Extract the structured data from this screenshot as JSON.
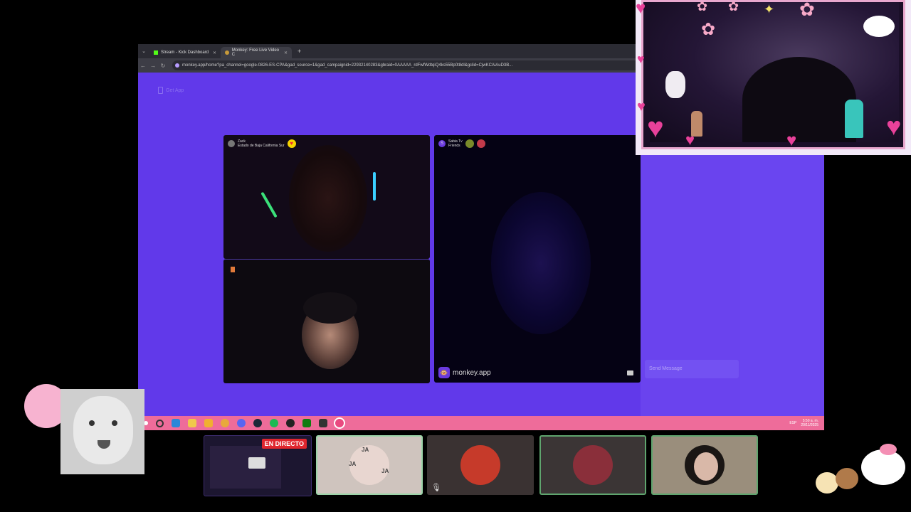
{
  "browser": {
    "tabs": [
      {
        "label": "Stream - Kick Dashboard",
        "active": false
      },
      {
        "label": "Monkey: Free Live Video C",
        "active": true
      }
    ],
    "url": "monkey.app/home?pa_channel=google-0826-ES-CPA&gad_source=1&gad_campaignid=22932140283&gbraid=0AAAAA_rdFwfWdtqiQ4ks55Bp0t8dl&gclid=CjwKCAiAuD3B...",
    "get_app_label": "Get App"
  },
  "video": {
    "top_left_user": {
      "name": "Zack",
      "location": "Estado de Baja California Sur"
    },
    "right_user": {
      "initial": "S",
      "name": "Sabia Tv",
      "status": "Friends"
    },
    "brand": "monkey.app"
  },
  "chat": {
    "send_placeholder": "Send Message"
  },
  "taskbar": {
    "status": "ESP",
    "time": "5:50 a. m.",
    "date": "20/11/2025"
  },
  "bottom_strip": {
    "live_label": "EN DIRECTO",
    "ja_text": "JA"
  },
  "colors": {
    "page_bg": "#6139ea",
    "taskbar": "#ee6c9a",
    "live_red": "#e0262e"
  }
}
